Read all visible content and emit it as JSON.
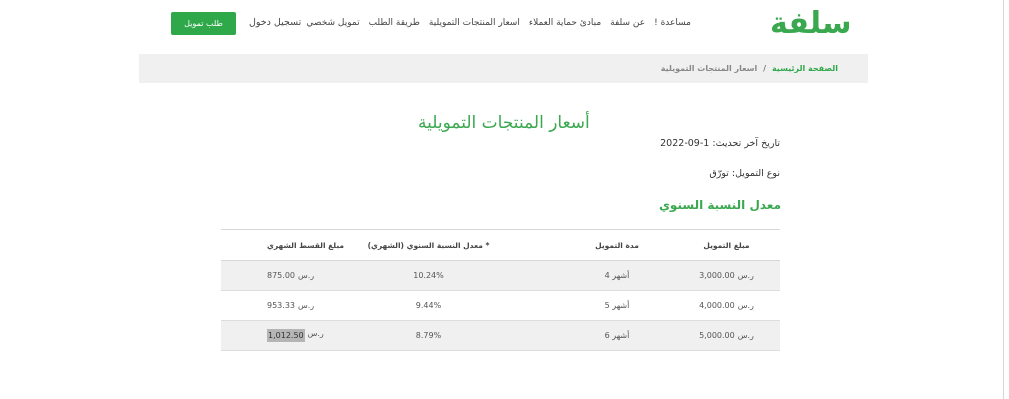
{
  "header": {
    "logo_text": "سلفة",
    "nav_items": [
      "تمويل شخصي",
      "طريقة الطلب",
      "اسعار المنتجات التمويلية",
      "مبادئ حماية العملاء",
      "عن سلفة",
      "مساعدة !"
    ],
    "login_label": "تسجيل دخول",
    "apply_button_label": "طلب تمويل"
  },
  "breadcrumb": {
    "home": "الصفحة الرئيسية",
    "separator": "/",
    "current": "اسعار المنتجات التمويلية"
  },
  "main": {
    "title": "أسعار المنتجات التمويلية",
    "last_update": "تاريخ آخر تحديث: 1-09-2022",
    "financing_type": "نوع التمويل: تورّق",
    "section_title": "معدل النسبة السنوي"
  },
  "table": {
    "headers": [
      "مبلغ التمويل",
      "مدة التمويل",
      "معدل النسبة السنوي (الشهري) *",
      "مبلغ القسط الشهري"
    ],
    "currency": "ر.س",
    "rows": [
      {
        "amount": "3,000.00",
        "currency": "ر.س",
        "duration": "4 أشهر",
        "apr": "10.24%",
        "installment": "875.00"
      },
      {
        "amount": "4,000.00",
        "currency": "ر.س",
        "duration": "5 أشهر",
        "apr": "9.44%",
        "installment": "953.33"
      },
      {
        "amount": "5,000.00",
        "currency": "ر.س",
        "duration": "6 أشهر",
        "apr": "8.79%",
        "installment": "1,012.50"
      }
    ]
  },
  "colors": {
    "brand_green": "#2fa84a",
    "breadcrumb_bg": "#f0f0f0",
    "row_shade": "#f0f0f0"
  }
}
